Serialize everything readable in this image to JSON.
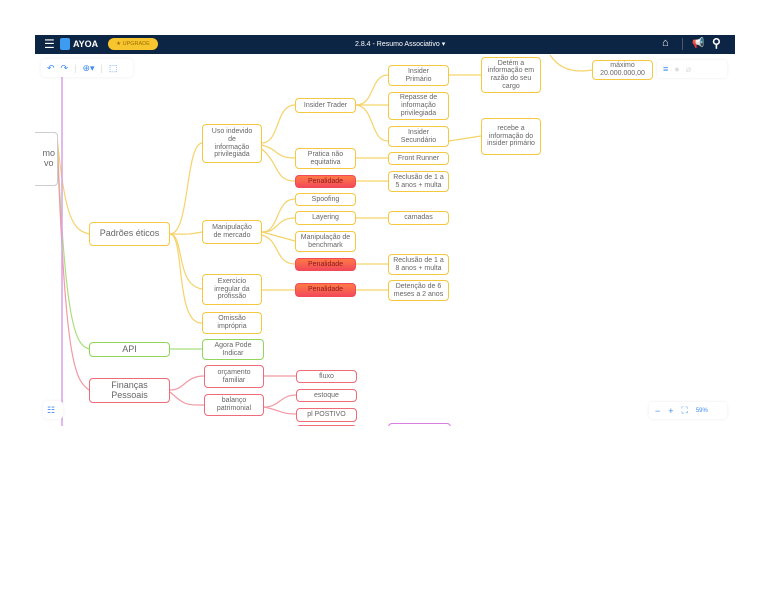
{
  "header": {
    "brand": "AYOA",
    "upgrade": "UPGRADE",
    "title": "2.8.4 - Resumo Associativo"
  },
  "root": {
    "label": "mo\nvo"
  },
  "nodes": {
    "padroes": "Padrões éticos",
    "uso": "Uso indevido\nde\ninformação\nprivilegiada",
    "insider_trader": "Insider Trader",
    "insider_primario": "Insider\nPrimário",
    "repasse": "Repasse de\ninformação\nprivilegiada",
    "insider_secundario": "Insider\nSecundário",
    "detem": "Detém a\ninformação em\nrazão do seu\ncargo",
    "recebe": "recebe a\ninformação do\ninsider primário",
    "maximo": "máximo\n20.000.000,00",
    "pratica": "Pratica não\nequitativa",
    "front_runner": "Front Runner",
    "penalidade1": "Penalidade",
    "reclusao15": "Reclusão de 1 a\n5 anos + multa",
    "spoofing": "Spoofing",
    "layering": "Layering",
    "camadas": "camadas",
    "manip_mercado": "Manipulação\nde mercado",
    "manip_bench": "Manipulação de\nbenchmark",
    "penalidade2": "Penalidade",
    "reclusao18": "Reclusão de 1 a\n8 anos + multa",
    "exercicio": "Exercicio\nirregular da\nprofissão",
    "penalidade3": "Penalidade",
    "detencao": "Detenção de 6\nmeses a 2 anos",
    "omissao": "Omissão\nimprópria",
    "api": "API",
    "agora": "Agora Pode\nIndicar",
    "financas": "Finanças\nPessoais",
    "orcamento": "orçamento\nfamiliar",
    "fluxo": "fluxo",
    "balanco": "balanço\npatrimonial",
    "estoque": "estoque",
    "pl": "pl POSTIVO"
  },
  "zoom": {
    "minus": "−",
    "plus": "+",
    "level": "59%"
  }
}
